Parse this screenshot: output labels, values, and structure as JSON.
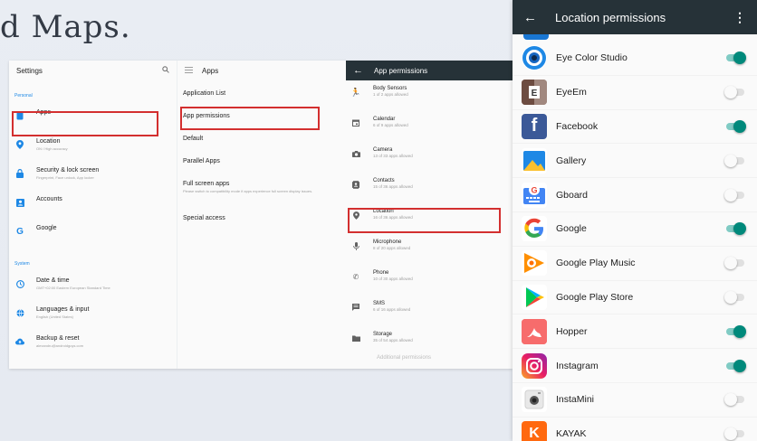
{
  "heading": "d Maps.",
  "settings": {
    "title": "Settings",
    "section_personal": "Personal",
    "section_system": "System",
    "items": [
      {
        "label": "Apps",
        "sub": ""
      },
      {
        "label": "Location",
        "sub": "ON / High accuracy"
      },
      {
        "label": "Security & lock screen",
        "sub": "Fingerprint, Face unlock, App locker"
      },
      {
        "label": "Accounts",
        "sub": ""
      },
      {
        "label": "Google",
        "sub": ""
      }
    ],
    "system_items": [
      {
        "label": "Date & time",
        "sub": "GMT+02:00 Eastern European Standard Time"
      },
      {
        "label": "Languages & input",
        "sub": "English (United States)"
      },
      {
        "label": "Backup & reset",
        "sub": "alexandru@androidguys.com"
      }
    ]
  },
  "apps_pane": {
    "title": "Apps",
    "items": [
      {
        "label": "Application List",
        "sub": ""
      },
      {
        "label": "App permissions",
        "sub": ""
      },
      {
        "label": "Default",
        "sub": ""
      },
      {
        "label": "Parallel Apps",
        "sub": ""
      },
      {
        "label": "Full screen apps",
        "sub": "Please switch to compatibility mode if apps experience full screen display issues."
      },
      {
        "label": "Special access",
        "sub": ""
      }
    ]
  },
  "permissions_pane": {
    "title": "App permissions",
    "items": [
      {
        "label": "Body Sensors",
        "sub": "1 of 2 apps allowed"
      },
      {
        "label": "Calendar",
        "sub": "6 of 9 apps allowed"
      },
      {
        "label": "Camera",
        "sub": "13 of 33 apps allowed"
      },
      {
        "label": "Contacts",
        "sub": "15 of 36 apps allowed"
      },
      {
        "label": "Location",
        "sub": "16 of 36 apps allowed"
      },
      {
        "label": "Microphone",
        "sub": "8 of 20 apps allowed"
      },
      {
        "label": "Phone",
        "sub": "10 of 30 apps allowed"
      },
      {
        "label": "SMS",
        "sub": "6 of 16 apps allowed"
      },
      {
        "label": "Storage",
        "sub": "35 of 54 apps allowed"
      }
    ],
    "cut_label": "Additional permissions"
  },
  "location_permissions": {
    "title": "Location permissions",
    "apps": [
      {
        "name": "Eye Color Studio",
        "on": true,
        "icon": "eye-color-studio-icon"
      },
      {
        "name": "EyeEm",
        "on": false,
        "icon": "eyeem-icon"
      },
      {
        "name": "Facebook",
        "on": true,
        "icon": "facebook-icon"
      },
      {
        "name": "Gallery",
        "on": false,
        "icon": "gallery-icon"
      },
      {
        "name": "Gboard",
        "on": false,
        "icon": "gboard-icon"
      },
      {
        "name": "Google",
        "on": true,
        "icon": "google-icon"
      },
      {
        "name": "Google Play Music",
        "on": false,
        "icon": "google-play-music-icon"
      },
      {
        "name": "Google Play Store",
        "on": false,
        "icon": "google-play-store-icon"
      },
      {
        "name": "Hopper",
        "on": true,
        "icon": "hopper-icon"
      },
      {
        "name": "Instagram",
        "on": true,
        "icon": "instagram-icon"
      },
      {
        "name": "InstaMini",
        "on": false,
        "icon": "instamini-icon"
      },
      {
        "name": "KAYAK",
        "on": false,
        "icon": "kayak-icon"
      }
    ]
  },
  "colors": {
    "accent_teal": "#00897b",
    "highlight_red": "#d32f2f",
    "toolbar_dark": "#263238",
    "settings_icon_blue": "#1e88e5"
  }
}
